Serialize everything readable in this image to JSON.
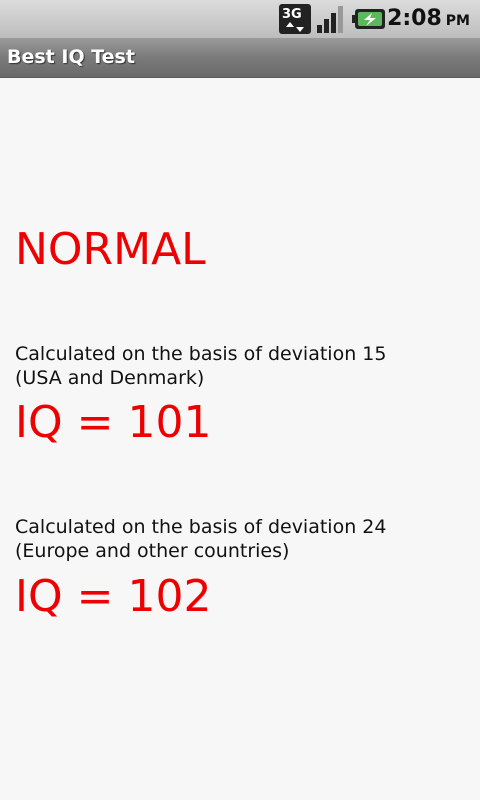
{
  "status_bar": {
    "network_type": "3G",
    "time": "2:08",
    "ampm": "PM",
    "icons": [
      "3g-icon",
      "signal-icon",
      "battery-charging-icon"
    ]
  },
  "app": {
    "title": "Best IQ Test"
  },
  "result": {
    "verdict": "NORMAL",
    "blocks": [
      {
        "line1": "Calculated on the basis of deviation 15",
        "line2": "(USA and Denmark)",
        "iq": "IQ = 101"
      },
      {
        "line1": "Calculated on the basis of deviation 24",
        "line2": "(Europe and other countries)",
        "iq": "IQ = 102"
      }
    ]
  },
  "colors": {
    "accent": "#ee0000",
    "background": "#f7f7f7",
    "title_bar": "#7b7b7b"
  }
}
